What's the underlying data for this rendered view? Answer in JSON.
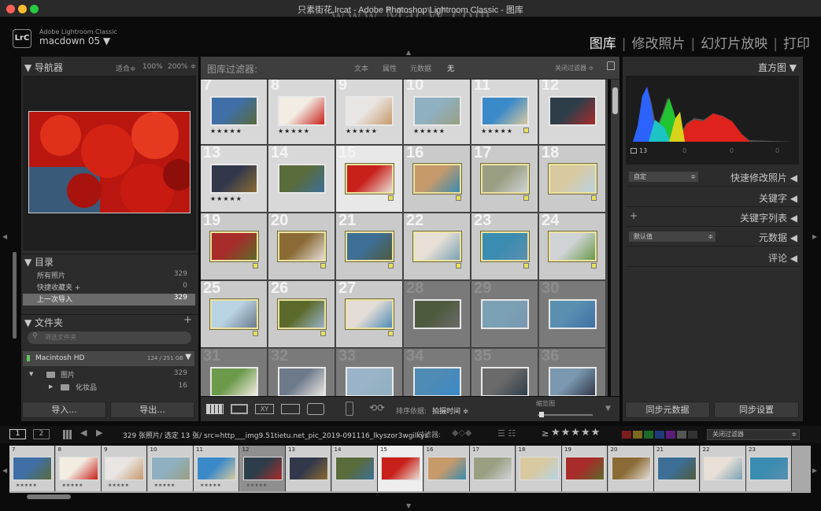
{
  "window": {
    "title": "只素街花.lrcat - Adobe Photoshop Lightroom Classic - 图库",
    "watermark": "www.MacW.com"
  },
  "identity": {
    "app": "Adobe Lightroom Classic",
    "catalog": "macdown 05",
    "logo": "LrC"
  },
  "modules": [
    "图库",
    "修改照片",
    "幻灯片放映",
    "打印"
  ],
  "navigator": {
    "title": "导航器",
    "zoom_fit": "适合",
    "zoom_100": "100%",
    "zoom_200": "200%"
  },
  "catalog": {
    "title": "目录",
    "items": [
      {
        "label": "所有照片",
        "count": "329"
      },
      {
        "label": "快捷收藏夹 +",
        "count": "0"
      },
      {
        "label": "上一次导入",
        "count": "329"
      }
    ]
  },
  "folders": {
    "title": "文件夹",
    "search_placeholder": "筛选文件夹",
    "volume": "Macintosh HD",
    "volume_size": "124 / 251 GB",
    "items": [
      {
        "label": "图片",
        "count": "329"
      },
      {
        "label": "化妆品",
        "count": "16"
      }
    ]
  },
  "left_buttons": {
    "import": "导入...",
    "export": "导出..."
  },
  "filter_bar": {
    "title": "图库过滤器:",
    "tabs": [
      "文本",
      "属性",
      "元数据",
      "无"
    ],
    "close": "关闭过滤器"
  },
  "grid_cells": [
    {
      "n": "7",
      "c": "#d8d8d8",
      "stars": "★★★★★",
      "sel": false,
      "flag": false
    },
    {
      "n": "8",
      "c": "#d8d8d8",
      "stars": "★★★★★",
      "sel": false,
      "flag": false
    },
    {
      "n": "9",
      "c": "#d8d8d8",
      "stars": "★★★★★",
      "sel": false,
      "flag": false
    },
    {
      "n": "10",
      "c": "#d8d8d8",
      "stars": "★★★★★",
      "sel": false,
      "flag": false
    },
    {
      "n": "11",
      "c": "#d8d8d8",
      "stars": "★★★★★",
      "sel": false,
      "flag": true
    },
    {
      "n": "12",
      "c": "#d8d8d8",
      "stars": "",
      "sel": false,
      "flag": false
    },
    {
      "n": "13",
      "c": "#d8d8d8",
      "stars": "★★★★★",
      "sel": false,
      "flag": false
    },
    {
      "n": "14",
      "c": "#d8d8d8",
      "stars": "",
      "sel": false,
      "flag": false
    },
    {
      "n": "15",
      "c": "#e8e8e8",
      "stars": "",
      "sel": true,
      "flag": true
    },
    {
      "n": "16",
      "c": "#cacaca",
      "stars": "",
      "sel": true,
      "flag": true
    },
    {
      "n": "17",
      "c": "#cacaca",
      "stars": "",
      "sel": true,
      "flag": true
    },
    {
      "n": "18",
      "c": "#cacaca",
      "stars": "",
      "sel": true,
      "flag": true
    },
    {
      "n": "19",
      "c": "#cacaca",
      "stars": "",
      "sel": true,
      "flag": true
    },
    {
      "n": "20",
      "c": "#cacaca",
      "stars": "",
      "sel": true,
      "flag": true
    },
    {
      "n": "21",
      "c": "#cacaca",
      "stars": "",
      "sel": true,
      "flag": true
    },
    {
      "n": "22",
      "c": "#cacaca",
      "stars": "",
      "sel": true,
      "flag": true
    },
    {
      "n": "23",
      "c": "#cacaca",
      "stars": "",
      "sel": true,
      "flag": true
    },
    {
      "n": "24",
      "c": "#cacaca",
      "stars": "",
      "sel": true,
      "flag": true
    },
    {
      "n": "25",
      "c": "#cacaca",
      "stars": "",
      "sel": true,
      "flag": true
    },
    {
      "n": "26",
      "c": "#cacaca",
      "stars": "",
      "sel": true,
      "flag": true
    },
    {
      "n": "27",
      "c": "#cacaca",
      "stars": "",
      "sel": true,
      "flag": true
    },
    {
      "n": "28",
      "c": "#7a7a7a",
      "stars": "",
      "sel": false,
      "flag": false
    },
    {
      "n": "29",
      "c": "#7a7a7a",
      "stars": "",
      "sel": false,
      "flag": false
    },
    {
      "n": "30",
      "c": "#7a7a7a",
      "stars": "",
      "sel": false,
      "flag": false
    },
    {
      "n": "31",
      "c": "#7a7a7a",
      "stars": "",
      "sel": false,
      "flag": false
    },
    {
      "n": "32",
      "c": "#7a7a7a",
      "stars": "",
      "sel": false,
      "flag": false
    },
    {
      "n": "33",
      "c": "#7a7a7a",
      "stars": "",
      "sel": false,
      "flag": false
    },
    {
      "n": "34",
      "c": "#7a7a7a",
      "stars": "",
      "sel": false,
      "flag": false
    },
    {
      "n": "35",
      "c": "#7a7a7a",
      "stars": "",
      "sel": false,
      "flag": false
    },
    {
      "n": "36",
      "c": "#7a7a7a",
      "stars": "",
      "sel": false,
      "flag": false
    }
  ],
  "toolbar": {
    "sort_label": "排序依据:",
    "sort_value": "拍摄时间",
    "thumb_label": "缩览图"
  },
  "histogram": {
    "title": "直方图",
    "values": [
      "13",
      "0",
      "0",
      "0"
    ]
  },
  "right_panels": {
    "preset_value": "自定",
    "quick_develop": "快速修改照片",
    "keywords": "关键字",
    "keyword_list": "关键字列表",
    "metadata_value": "默认值",
    "metadata": "元数据",
    "comments": "评论"
  },
  "right_buttons": {
    "sync_metadata": "同步元数据",
    "sync_settings": "同步设置"
  },
  "filmstrip_bar": {
    "page1": "1",
    "page2": "2",
    "info": "329 张照片/ 选定 13 张/ src=http___img9.51tietu.net_pic_2019-091116_lkyszor3wgilkys",
    "filter_label": "过滤器:",
    "rating_op": "≥",
    "filter_close": "关闭过滤器"
  },
  "filmstrip": [
    {
      "n": "7",
      "c": "#cfcfcf"
    },
    {
      "n": "8",
      "c": "#cfcfcf"
    },
    {
      "n": "9",
      "c": "#cfcfcf"
    },
    {
      "n": "10",
      "c": "#cfcfcf"
    },
    {
      "n": "11",
      "c": "#cfcfcf"
    },
    {
      "n": "12",
      "c": "#8f8f8f"
    },
    {
      "n": "13",
      "c": "#cfcfcf"
    },
    {
      "n": "14",
      "c": "#cfcfcf"
    },
    {
      "n": "15",
      "c": "#eeeeee"
    },
    {
      "n": "16",
      "c": "#cfcfcf"
    },
    {
      "n": "17",
      "c": "#cfcfcf"
    },
    {
      "n": "18",
      "c": "#cfcfcf"
    },
    {
      "n": "19",
      "c": "#cfcfcf"
    },
    {
      "n": "20",
      "c": "#cfcfcf"
    },
    {
      "n": "21",
      "c": "#cfcfcf"
    },
    {
      "n": "22",
      "c": "#cfcfcf"
    },
    {
      "n": "23",
      "c": "#cfcfcf"
    }
  ],
  "thumbnail_colors": [
    "#3f6fa6",
    "#f2ece2",
    "#e9e5e3",
    "#8fb0c0",
    "#3a89c8",
    "#2d3e4a",
    "#32384a",
    "#5a6b3c",
    "#c8201a",
    "#c79a6c",
    "#9a9f83",
    "#d8c9a0",
    "#a82c2a",
    "#8b6b35",
    "#3d6f96",
    "#e8e0d6",
    "#3a8cb0",
    "#cfd3d6",
    "#b9d3e2",
    "#5b6a2a",
    "#e4ddd7",
    "#4e5a3e",
    "#7ba1b5",
    "#5a8fb0",
    "#6b9a4a",
    "#6d7a8a",
    "#9ab3c8",
    "#4e8bb5",
    "#6a6a6a",
    "#7a98b0"
  ],
  "colors": {
    "accent_flag": "#e8e05a",
    "selected_border": "#ece3a0",
    "red_tl": "#fe5f57",
    "yellow_tl": "#febc2e",
    "green_tl": "#28c840"
  }
}
